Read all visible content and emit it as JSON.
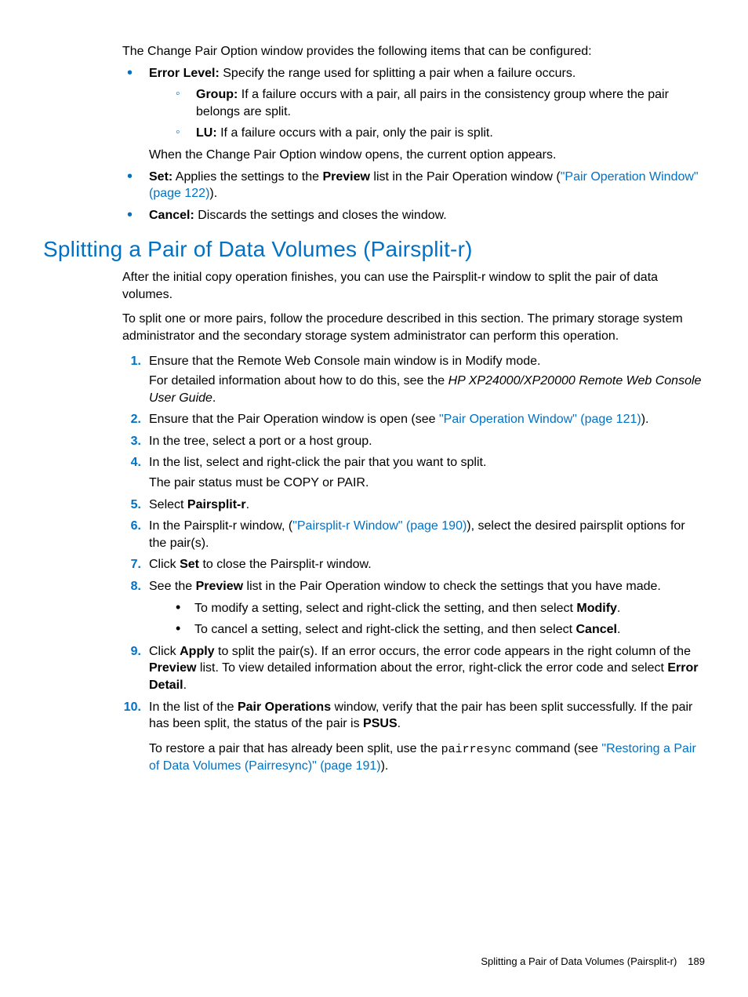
{
  "intro": "The Change Pair Option window provides the following items that can be configured:",
  "bullets": {
    "error_level_label": "Error Level:",
    "error_level_text": " Specify the range used for splitting a pair when a failure occurs.",
    "group_label": "Group:",
    "group_text": " If a failure occurs with a pair, all pairs in the consistency group where the pair belongs are split.",
    "lu_label": "LU:",
    "lu_text": " If a failure occurs with a pair, only the pair is split.",
    "after_sub": "When the Change Pair Option window opens, the current option appears.",
    "set_label": "Set:",
    "set_text_before": " Applies the settings to the ",
    "preview_bold": "Preview",
    "set_text_after": " list in the Pair Operation window (",
    "set_link": "\"Pair Operation Window\" (page 122)",
    "set_close": ").",
    "cancel_label": "Cancel:",
    "cancel_text": " Discards the settings and closes the window."
  },
  "heading": "Splitting a Pair of Data Volumes (Pairsplit-r)",
  "p1": "After the initial copy operation finishes, you can use the Pairsplit-r window to split the pair of data volumes.",
  "p2": "To split one or more pairs, follow the procedure described in this section. The primary storage system administrator and the secondary storage system administrator can perform this operation.",
  "steps": {
    "s1a": "Ensure that the Remote Web Console main window is in Modify mode.",
    "s1b_before": "For detailed information about how to do this, see the ",
    "s1b_italic": "HP XP24000/XP20000 Remote Web Console User Guide",
    "s1b_after": ".",
    "s2_before": "Ensure that the Pair Operation window is open (see ",
    "s2_link": "\"Pair Operation Window\" (page 121)",
    "s2_after": ").",
    "s3": "In the tree, select a port or a host group.",
    "s4a": "In the list, select and right-click the pair that you want to split.",
    "s4b": "The pair status must be COPY or PAIR.",
    "s5_before": "Select ",
    "s5_bold": "Pairsplit-r",
    "s5_after": ".",
    "s6_before": "In the Pairsplit-r window, (",
    "s6_link": "\"Pairsplit-r Window\" (page 190)",
    "s6_after": "), select the desired pairsplit options for the pair(s).",
    "s7_before": "Click ",
    "s7_bold": "Set",
    "s7_after": " to close the Pairsplit-r window.",
    "s8_before": "See the ",
    "s8_bold": "Preview",
    "s8_after": " list in the Pair Operation window to check the settings that you have made.",
    "s8_sub1_before": "To modify a setting, select and right-click the setting, and then select ",
    "s8_sub1_bold": "Modify",
    "s8_sub1_after": ".",
    "s8_sub2_before": "To cancel a setting, select and right-click the setting, and then select ",
    "s8_sub2_bold": "Cancel",
    "s8_sub2_after": ".",
    "s9_before": "Click ",
    "s9_bold1": "Apply",
    "s9_mid": " to split the pair(s). If an error occurs, the error code appears in the right column of the ",
    "s9_bold2": "Preview",
    "s9_mid2": " list. To view detailed information about the error, right-click the error code and select ",
    "s9_bold3": "Error Detail",
    "s9_after": ".",
    "s10a_before": "In the list of the ",
    "s10a_bold1": "Pair Operations",
    "s10a_mid": " window, verify that the pair has been split successfully. If the pair has been split, the status of the pair is ",
    "s10a_bold2": "PSUS",
    "s10a_after": ".",
    "s10b_before": "To restore a pair that has already been split, use the ",
    "s10b_code": "pairresync",
    "s10b_mid": " command (see ",
    "s10b_link": "\"Restoring a Pair of Data Volumes (Pairresync)\" (page 191)",
    "s10b_after": ")."
  },
  "footer": {
    "title": "Splitting a Pair of Data Volumes (Pairsplit-r)",
    "page": "189"
  }
}
